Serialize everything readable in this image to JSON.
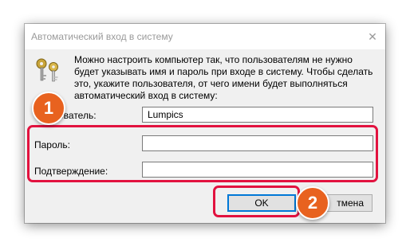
{
  "dialog": {
    "title": "Автоматический вход в систему",
    "close_glyph": "✕",
    "icon": "keys-icon",
    "description": "Можно настроить компьютер так, что пользователям не нужно будет указывать имя и пароль при входе в систему. Чтобы сделать это, укажите пользователя, от чего имени будет выполняться автоматический вход в систему:",
    "user_label": "ователь:",
    "user_value": "Lumpics",
    "password_label": "Пароль:",
    "password_value": "",
    "confirm_label": "Подтверждение:",
    "confirm_value": "",
    "ok_label": "OK",
    "cancel_label": "тмена"
  },
  "annotations": {
    "step1": "1",
    "step2": "2",
    "highlight_color": "#e2123f",
    "badge_color": "#e8621f"
  }
}
